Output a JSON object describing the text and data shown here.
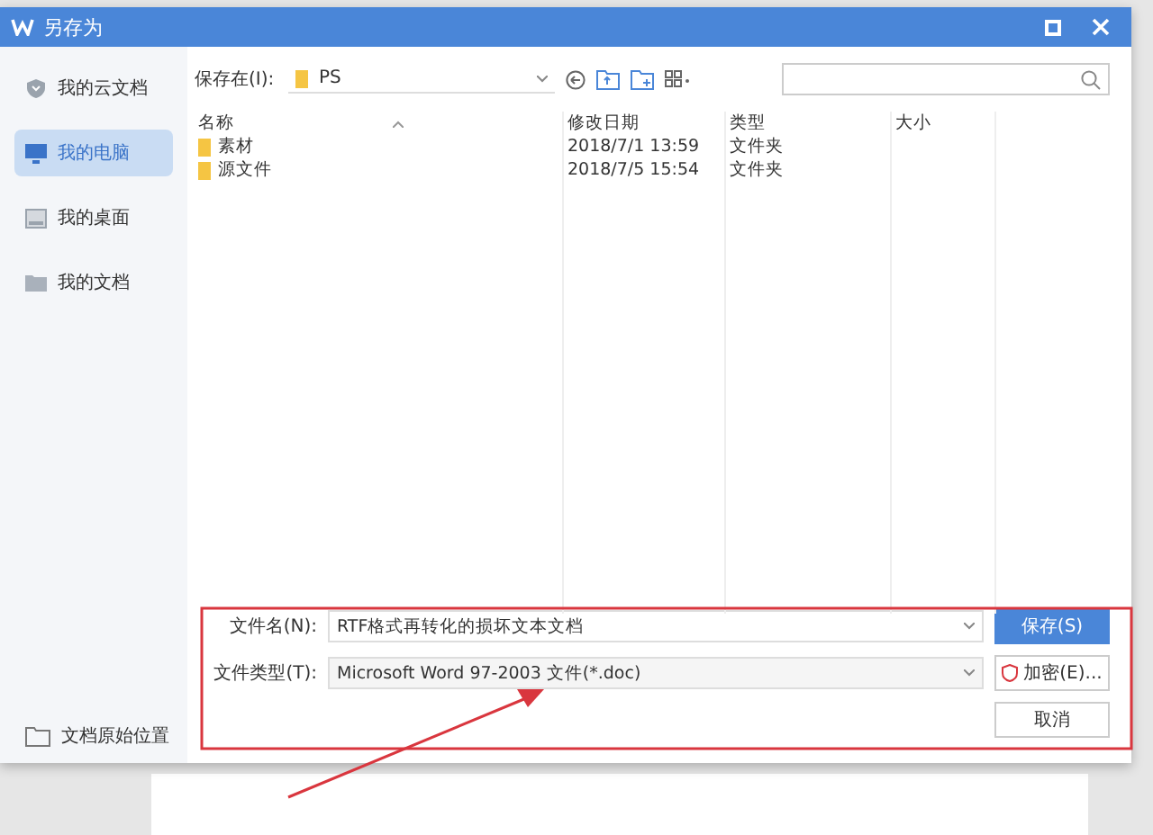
{
  "window": {
    "title": "另存为"
  },
  "sidebar": {
    "items": [
      {
        "label": "我的云文档",
        "kind": "cloud",
        "selected": false
      },
      {
        "label": "我的电脑",
        "kind": "computer",
        "selected": true
      },
      {
        "label": "我的桌面",
        "kind": "desktop",
        "selected": false
      },
      {
        "label": "我的文档",
        "kind": "folder",
        "selected": false
      }
    ],
    "footer": "文档原始位置"
  },
  "location": {
    "label": "保存在(I):",
    "value": "PS"
  },
  "file_list": {
    "columns": [
      "名称",
      "修改日期",
      "类型",
      "大小"
    ],
    "rows": [
      {
        "name": "素材",
        "modified": "2018/7/1 13:59",
        "type": "文件夹"
      },
      {
        "name": "源文件",
        "modified": "2018/7/5 15:54",
        "type": "文件夹"
      }
    ]
  },
  "form": {
    "filename": {
      "label": "文件名(N):",
      "value": "RTF格式再转化的损坏文本文档"
    },
    "filetype": {
      "label": "文件类型(T):",
      "value": "Microsoft Word 97-2003 文件(*.doc)"
    }
  },
  "buttons": [
    {
      "label": "保存(S)",
      "kind": "primary"
    },
    {
      "label": "加密(E)...",
      "kind": "encrypt"
    },
    {
      "label": "取消",
      "kind": "plain"
    }
  ]
}
